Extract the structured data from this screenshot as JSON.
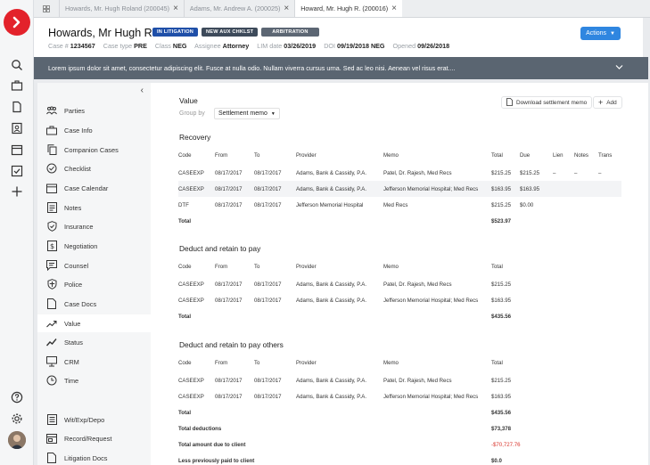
{
  "tabs": [
    {
      "label": "Howards, Mr. Hugh Roland (200045)",
      "active": false
    },
    {
      "label": "Adams, Mr. Andrew A. (200025)",
      "active": false
    },
    {
      "label": "Howard, Mr. Hugh R. (200016)",
      "active": true
    }
  ],
  "header": {
    "title": "Howards, Mr Hugh R.",
    "badges": [
      {
        "label": "IN LITIGATION",
        "color": "#1f4fa8"
      },
      {
        "label": "NEW AUX CHKLST",
        "color": "#3d4a5a"
      },
      {
        "label": "ARBITRATION",
        "color": "#5c6673"
      }
    ],
    "meta": [
      {
        "label": "Case #",
        "value": "1234567"
      },
      {
        "label": "Case type",
        "value": "PRE"
      },
      {
        "label": "Class",
        "value": "NEG"
      },
      {
        "label": "Assignee",
        "value": "Attorney"
      },
      {
        "label": "LIM date",
        "value": "03/26/2019"
      },
      {
        "label": "DOI",
        "value": "09/19/2018 NEG"
      },
      {
        "label": "Opened",
        "value": "09/26/2018"
      }
    ],
    "actions_label": "Actions"
  },
  "banner": {
    "text": "Lorem ipsum dolor sit amet, consectetur adipiscing elit. Fusce at nulla odio. Nullam viverra cursus urna. Sed ac leo nisi. Aenean vel risus erat...."
  },
  "nav": {
    "items": [
      {
        "label": "Parties",
        "icon": "people-icon"
      },
      {
        "label": "Case Info",
        "icon": "briefcase-icon"
      },
      {
        "label": "Companion Cases",
        "icon": "copy-icon"
      },
      {
        "label": "Checklist",
        "icon": "check-circle-icon"
      },
      {
        "label": "Case Calendar",
        "icon": "calendar-icon"
      },
      {
        "label": "Notes",
        "icon": "notes-icon"
      },
      {
        "label": "Insurance",
        "icon": "shield-check-icon"
      },
      {
        "label": "Negotiation",
        "icon": "dollar-icon"
      },
      {
        "label": "Counsel",
        "icon": "chat-icon"
      },
      {
        "label": "Police",
        "icon": "badge-icon"
      },
      {
        "label": "Case Docs",
        "icon": "document-icon"
      },
      {
        "label": "Value",
        "icon": "trend-icon",
        "active": true
      },
      {
        "label": "Status",
        "icon": "trend-up-icon"
      },
      {
        "label": "CRM",
        "icon": "monitor-icon"
      },
      {
        "label": "Time",
        "icon": "clock-icon"
      },
      {
        "label": "Wit/Exp/Depo",
        "icon": "list-icon"
      },
      {
        "label": "Record/Request",
        "icon": "form-icon"
      },
      {
        "label": "Litigation Docs",
        "icon": "document-icon"
      }
    ]
  },
  "value": {
    "title": "Value",
    "group_by_label": "Group by",
    "group_by_value": "Settlement memo",
    "download_label": "Download settlement memo",
    "add_label": "Add",
    "recovery": {
      "title": "Recovery",
      "headers": [
        "Code",
        "From",
        "To",
        "Provider",
        "Memo",
        "Total",
        "Due",
        "Lien",
        "Notes",
        "Trans"
      ],
      "rows": [
        [
          "CASEEXP",
          "08/17/2017",
          "08/17/2017",
          "Adams, Bank & Cassidy, P.A.",
          "Patel, Dr. Rajesh, Med Recs",
          "$215.25",
          "$215.25",
          "–",
          "–",
          "–"
        ],
        [
          "CASEEXP",
          "08/17/2017",
          "08/17/2017",
          "Adams, Bank & Cassidy, P.A.",
          "Jefferson Memorial Hospital; Med Recs",
          "$163.95",
          "$163.95",
          "",
          "",
          ""
        ],
        [
          "DTF",
          "08/17/2017",
          "08/17/2017",
          "Jefferson Memorial Hospital",
          "Med Recs",
          "$215.25",
          "$0.00",
          "",
          "",
          ""
        ]
      ],
      "total_label": "Total",
      "total_value": "$523.97"
    },
    "deduct": {
      "title": "Deduct and retain to pay",
      "headers": [
        "Code",
        "From",
        "To",
        "Provider",
        "Memo",
        "Total"
      ],
      "rows": [
        [
          "CASEEXP",
          "08/17/2017",
          "08/17/2017",
          "Adams, Bank & Cassidy, P.A.",
          "Patel, Dr. Rajesh, Med Recs",
          "$215.25"
        ],
        [
          "CASEEXP",
          "08/17/2017",
          "08/17/2017",
          "Adams, Bank & Cassidy, P.A.",
          "Jefferson Memorial Hospital; Med Recs",
          "$163.95"
        ]
      ],
      "total_label": "Total",
      "total_value": "$435.56"
    },
    "deduct_others": {
      "title": "Deduct and retain to pay others",
      "headers": [
        "Code",
        "From",
        "To",
        "Provider",
        "Memo",
        "Total"
      ],
      "rows": [
        [
          "CASEEXP",
          "08/17/2017",
          "08/17/2017",
          "Adams, Bank & Cassidy, P.A.",
          "Patel, Dr. Rajesh, Med Recs",
          "$215.25"
        ],
        [
          "CASEEXP",
          "08/17/2017",
          "08/17/2017",
          "Adams, Bank & Cassidy, P.A.",
          "Jefferson Memorial Hospital; Med Recs",
          "$163.95"
        ]
      ],
      "total_label": "Total",
      "total_value": "$435.56"
    },
    "summary": [
      {
        "label": "Total deductions",
        "value": "$73,378",
        "negative": false
      },
      {
        "label": "Total amount due to client",
        "value": "-$70,727.76",
        "negative": true
      },
      {
        "label": "Less previously paid to client",
        "value": "$0.0",
        "negative": false
      }
    ]
  }
}
